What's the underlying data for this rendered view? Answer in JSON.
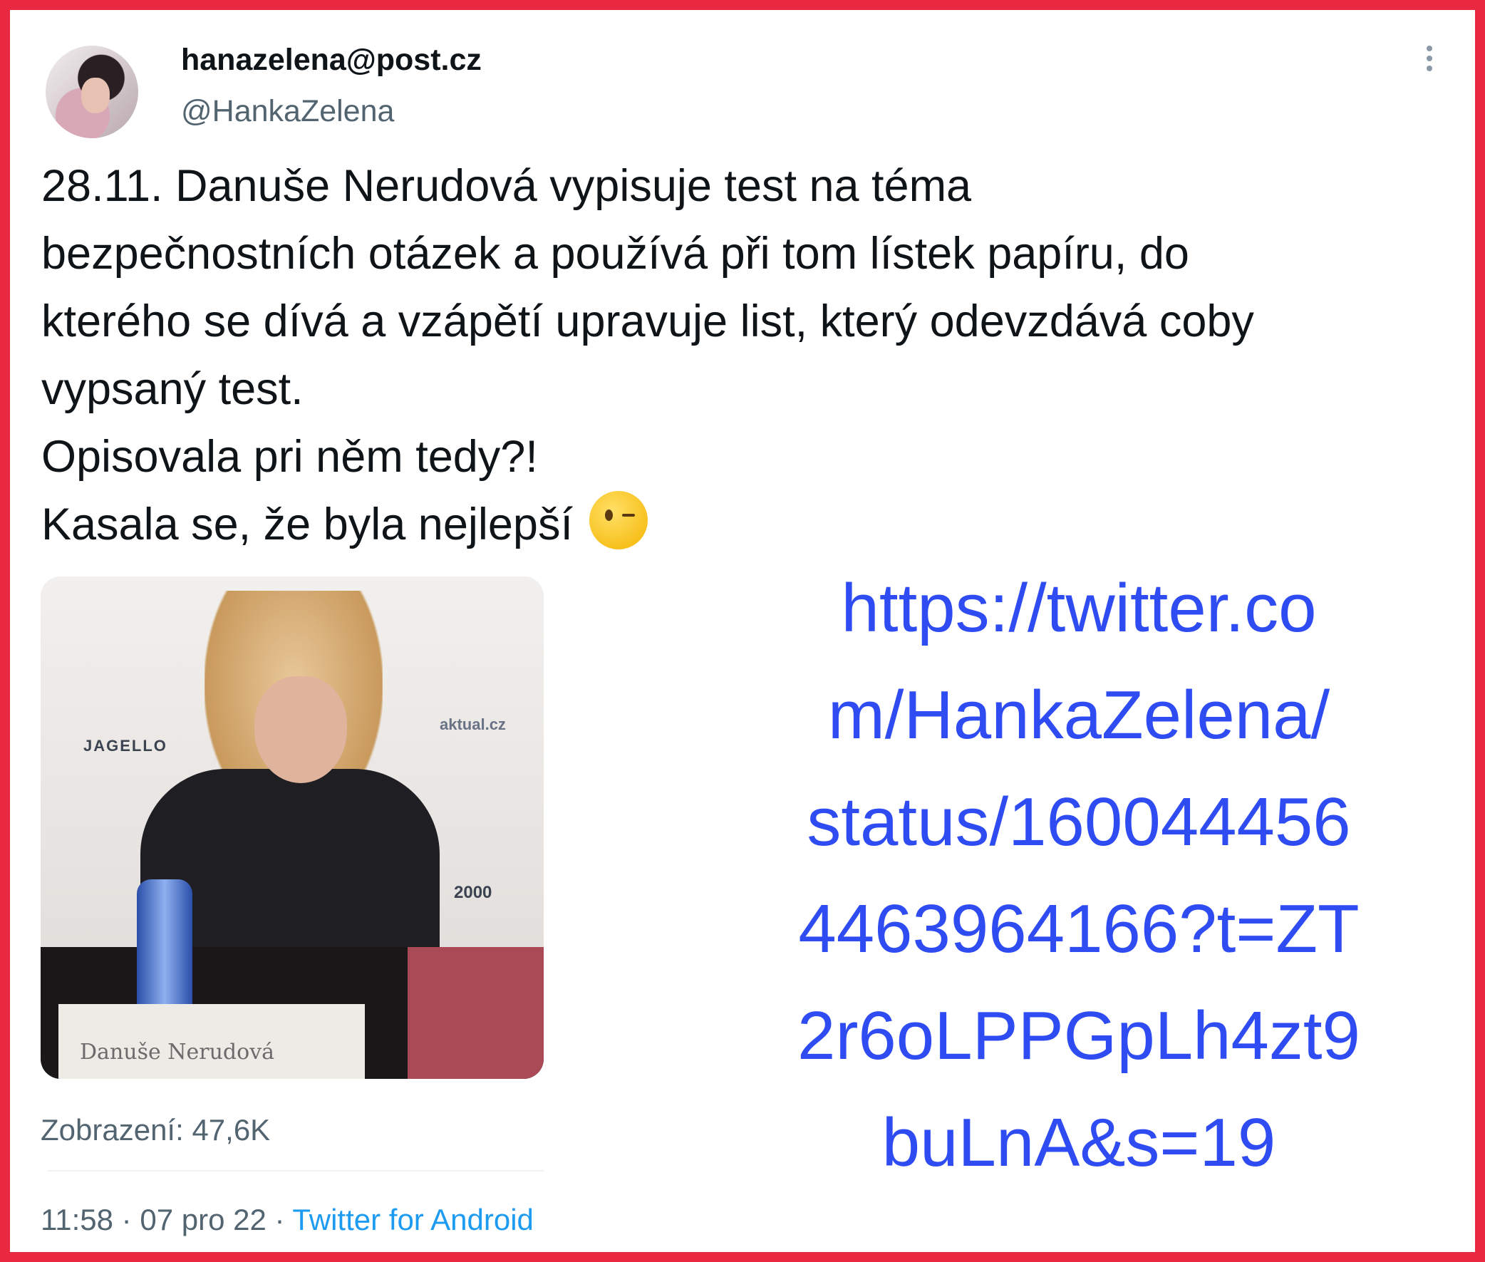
{
  "tweet": {
    "display_name": "hanazelena@post.cz",
    "handle": "@HankaZelena",
    "text_lines": [
      "28.11. Danuše Nerudová vypisuje test na téma",
      "bezpečnostních otázek a používá při tom lístek papíru, do",
      "kterého se dívá a vzápětí upravuje list, který odevzdává coby",
      "vypsaný test.",
      "Opisovala pri něm tedy?!",
      "Kasala se, že byla nejlepší"
    ],
    "emoji_icon": "winking-face-emoji",
    "views": "Zobrazení: 47,6K",
    "time": "11:58",
    "separator": "·",
    "date": "07 pro 22",
    "source": "Twitter for Android",
    "menu_icon": "more-vertical-icon"
  },
  "media": {
    "logo_left": "JAGELLO",
    "logo_right": "aktual.cz",
    "logo_bottom": "2000",
    "nameplate": "Danuše Nerudová"
  },
  "url_overlay": {
    "lines": [
      "https://twitter.co",
      "m/HankaZelena/",
      "status/160044456",
      "4463964166?t=ZT",
      "2r6oLPPGpLh4zt9",
      "buLnA&s=19"
    ]
  },
  "colors": {
    "border": "#e8293f",
    "link": "#1d9bf0",
    "url_text": "#2f4cf2",
    "muted": "#536471"
  }
}
